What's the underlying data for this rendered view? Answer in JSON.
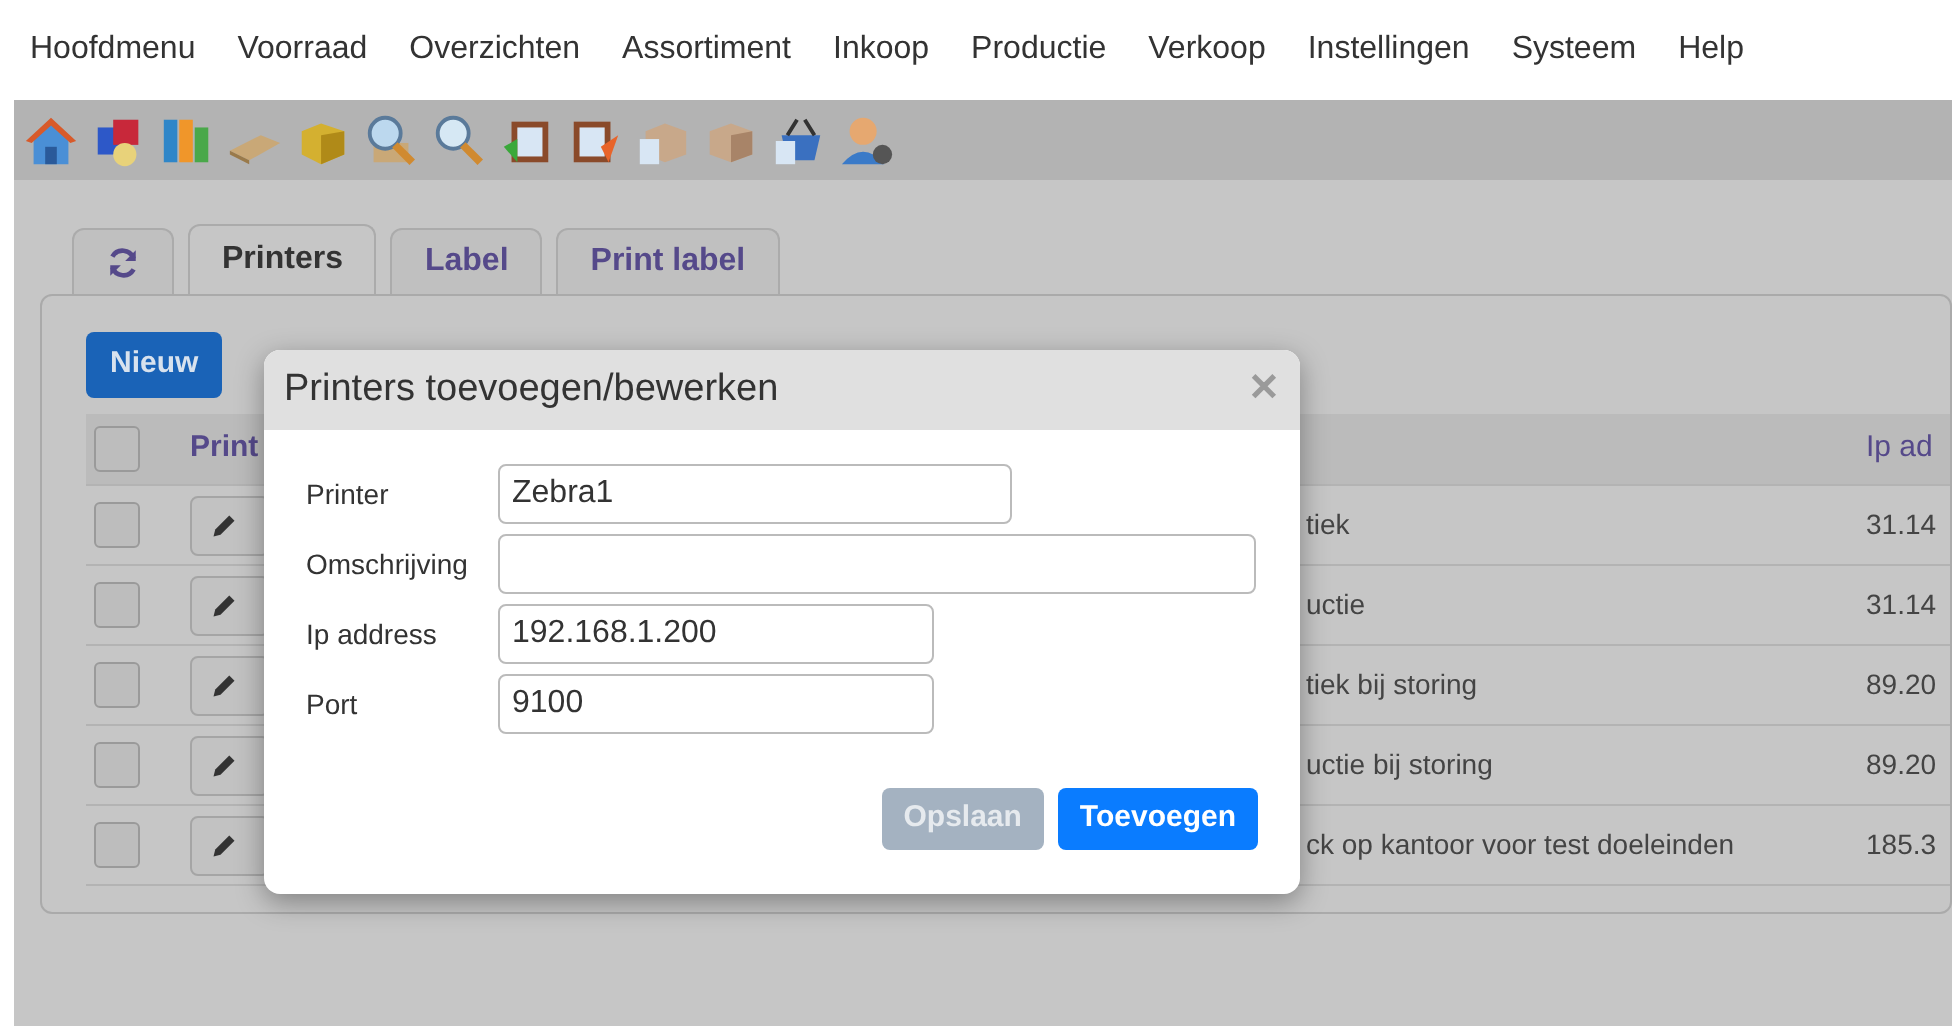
{
  "menu": [
    "Hoofdmenu",
    "Voorraad",
    "Overzichten",
    "Assortiment",
    "Inkoop",
    "Productie",
    "Verkoop",
    "Instellingen",
    "Systeem",
    "Help"
  ],
  "tabs": [
    {
      "kind": "icon",
      "selected": false
    },
    {
      "kind": "text",
      "label": "Printers",
      "selected": true
    },
    {
      "kind": "text",
      "label": "Label",
      "selected": false
    },
    {
      "kind": "text",
      "label": "Print label",
      "selected": false
    }
  ],
  "new_button": "Nieuw",
  "table": {
    "header_checked": false,
    "columns": [
      "Print",
      "Ip ad"
    ],
    "rows": [
      {
        "checked": false,
        "column_3": "tiek",
        "column_4": "31.14"
      },
      {
        "checked": false,
        "column_3": "uctie",
        "column_4": "31.14"
      },
      {
        "checked": false,
        "column_3": "tiek bij storing",
        "column_4": "89.20"
      },
      {
        "checked": false,
        "column_3": "uctie bij storing",
        "column_4": "89.20"
      },
      {
        "checked": false,
        "column_3": "ck op kantoor voor test doeleinden",
        "column_4": "185.3"
      }
    ]
  },
  "dialog": {
    "title": "Printers toevoegen/bewerken",
    "close": "✕",
    "fields": [
      {
        "label": "Printer",
        "value": "Zebra1"
      },
      {
        "label": "Omschrijving"
      },
      {
        "label": "Ip address",
        "value": "192.168.1.200"
      },
      {
        "label": "Port",
        "value": "9100"
      }
    ],
    "buttons": [
      {
        "label": "Opslaan",
        "disabled": true
      },
      {
        "label": "Toevoegen",
        "disabled": false
      }
    ]
  }
}
